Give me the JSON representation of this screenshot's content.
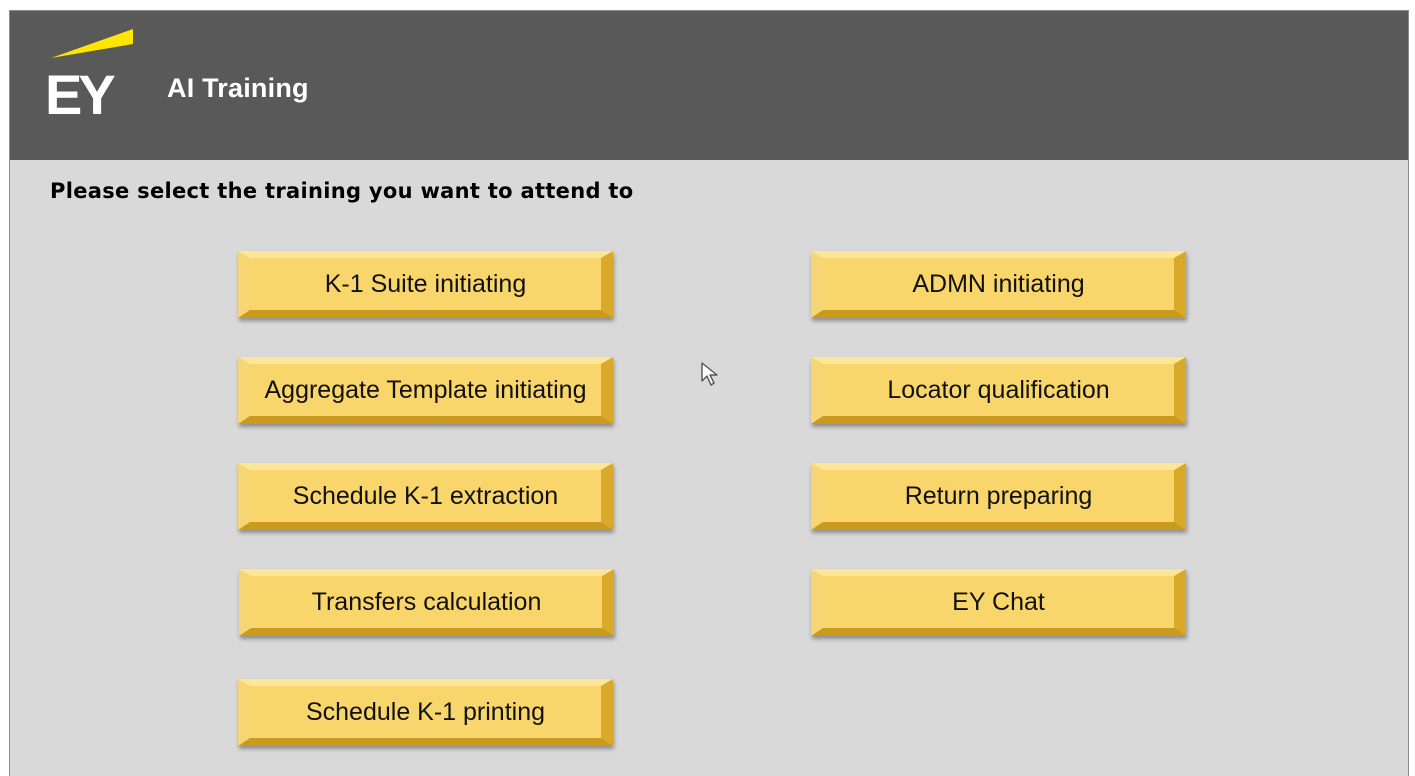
{
  "header": {
    "logo_text": "EY",
    "title": "AI Training"
  },
  "instruction": "Please select the training you want to attend to",
  "trainings": {
    "left": [
      "K-1 Suite initiating",
      "Aggregate Template initiating",
      "Schedule K-1 extraction",
      "Transfers calculation",
      "Schedule K-1 printing"
    ],
    "right": [
      "ADMN initiating",
      "Locator qualification",
      "Return preparing",
      "EY Chat"
    ]
  },
  "colors": {
    "header_bg": "#595959",
    "page_bg": "#d9d9d9",
    "button_face": "#f9d66b",
    "logo_beam": "#ffe600"
  },
  "icons": {
    "cursor": "arrow-cursor-icon"
  }
}
